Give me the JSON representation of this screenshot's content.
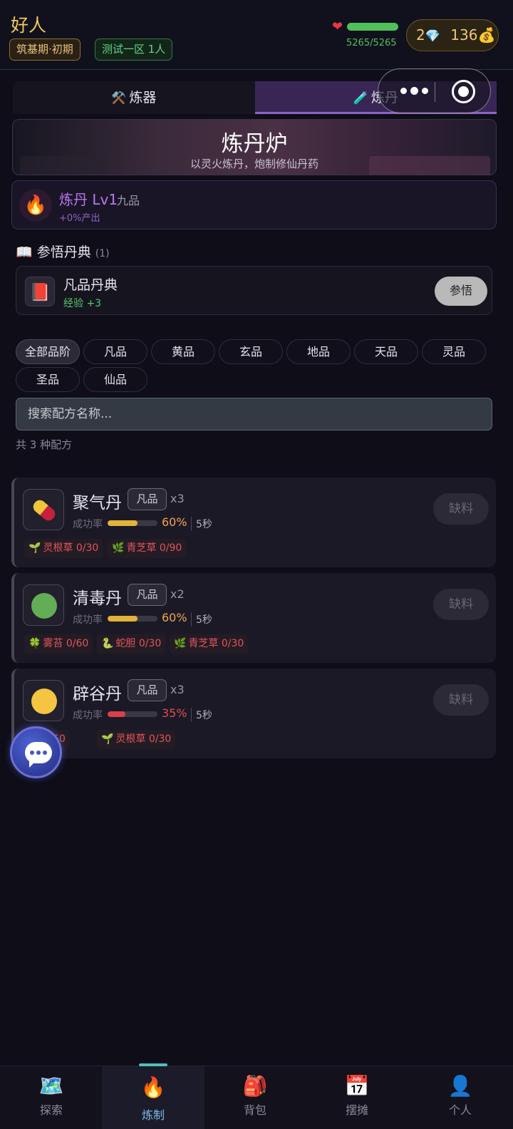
{
  "player": {
    "name": "好人",
    "realm": "筑基期·初期",
    "server": "测试一区 1人"
  },
  "hp": {
    "text": "5265/5265",
    "fraction": 1.0
  },
  "currency": {
    "gems": "2",
    "coins": "136",
    "gem_icon": "💎",
    "coin_icon": "💰"
  },
  "tabs": [
    {
      "icon": "⚒️",
      "label": "炼器",
      "active": false
    },
    {
      "icon": "🧪",
      "label": "炼丹",
      "active": true
    }
  ],
  "banner": {
    "title": "炼丹炉",
    "subtitle": "以灵火炼丹，炮制修仙丹药"
  },
  "skill": {
    "icon": "🔥",
    "name": "炼丹 Lv1",
    "grade": "九品",
    "bonus": "+0%产出"
  },
  "scripture_section": {
    "icon": "📖",
    "title": "参悟丹典",
    "count": "(1)"
  },
  "scripture": {
    "icon": "📕",
    "name": "凡品丹典",
    "exp": "经验 +3",
    "button": "参悟"
  },
  "filters": [
    "全部品阶",
    "凡品",
    "黄品",
    "玄品",
    "地品",
    "天品",
    "灵品",
    "圣品",
    "仙品"
  ],
  "search": {
    "placeholder": "搜索配方名称..."
  },
  "total": "共 3 种配方",
  "recipes": [
    {
      "name": "聚气丹",
      "grade": "凡品",
      "qty": "x3",
      "rate_label": "成功率",
      "rate": "60%",
      "rate_value": 0.6,
      "rate_color": "#f0a64a",
      "bar_color": "#e2b23a",
      "time": "5秒",
      "button": "缺料",
      "icon": "pill-icon",
      "materials": [
        {
          "icon": "🌱",
          "text": "灵根草 0/30"
        },
        {
          "icon": "🌿",
          "text": "青芝草 0/90"
        }
      ]
    },
    {
      "name": "清毒丹",
      "grade": "凡品",
      "qty": "x2",
      "rate_label": "成功率",
      "rate": "60%",
      "rate_value": 0.6,
      "rate_color": "#f0a64a",
      "bar_color": "#e2b23a",
      "time": "5秒",
      "button": "缺料",
      "icon": "green-pellet-icon",
      "materials": [
        {
          "icon": "🍀",
          "text": "雾苔 0/60"
        },
        {
          "icon": "🐍",
          "text": "蛇胆 0/30"
        },
        {
          "icon": "🌿",
          "text": "青芝草 0/30"
        }
      ]
    },
    {
      "name": "辟谷丹",
      "grade": "凡品",
      "qty": "x3",
      "rate_label": "成功率",
      "rate": "35%",
      "rate_value": 0.35,
      "rate_color": "#e24b4f",
      "bar_color": "#d8404a",
      "time": "5秒",
      "button": "缺料",
      "icon": "yellow-pellet-icon",
      "materials": [
        {
          "icon": "🌾",
          "text": "0/60"
        },
        {
          "icon": "🌱",
          "text": "灵根草 0/30"
        }
      ]
    }
  ],
  "nav": [
    {
      "icon": "🗺️",
      "label": "探索",
      "active": false
    },
    {
      "icon": "🔥",
      "label": "炼制",
      "active": true
    },
    {
      "icon": "🎒",
      "label": "背包",
      "active": false
    },
    {
      "icon": "📅",
      "label": "摆摊",
      "active": false
    },
    {
      "icon": "👤",
      "label": "个人",
      "active": false
    }
  ]
}
